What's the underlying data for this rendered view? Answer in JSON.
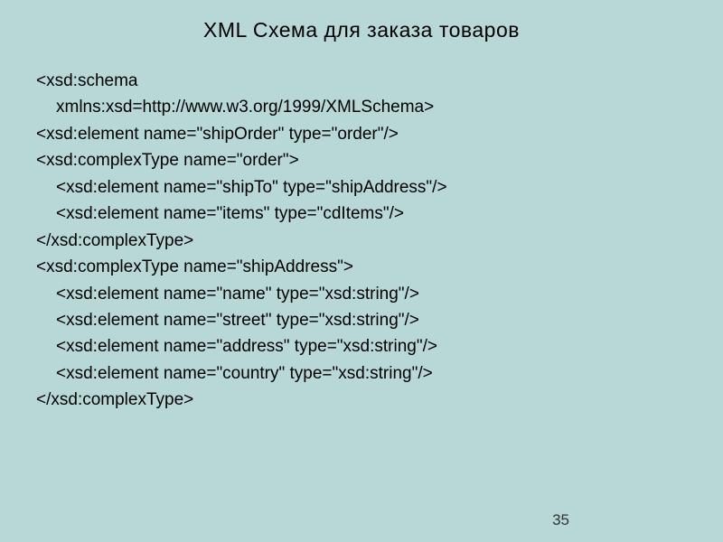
{
  "title": "XML Схема для заказа товаров",
  "code": {
    "line1": "<xsd:schema",
    "line2": "xmlns:xsd=http://www.w3.org/1999/XMLSchema>",
    "line3": "<xsd:element name=\"shipOrder\" type=\"order\"/>",
    "line4": "<xsd:complexType name=\"order\">",
    "line5": "<xsd:element name=\"shipTo\" type=\"shipAddress\"/>",
    "line6": "<xsd:element name=\"items\" type=\"cdItems\"/>",
    "line7": "</xsd:complexType>",
    "line8": "<xsd:complexType name=\"shipAddress\">",
    "line9": "<xsd:element name=\"name\" type=\"xsd:string\"/>",
    "line10": "<xsd:element name=\"street\" type=\"xsd:string\"/>",
    "line11": "<xsd:element name=\"address\" type=\"xsd:string\"/>",
    "line12": "<xsd:element name=\"country\" type=\"xsd:string\"/>",
    "line13": "</xsd:complexType>"
  },
  "pageNumber": "35"
}
